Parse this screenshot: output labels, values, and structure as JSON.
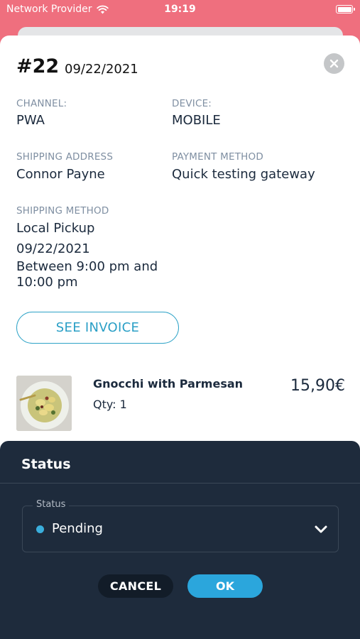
{
  "status_bar": {
    "carrier": "Network Provider",
    "time": "19:19",
    "wifi_icon": "wifi-icon",
    "battery_icon": "battery-icon"
  },
  "order": {
    "number": "#22",
    "date": "09/22/2021",
    "channel_label": "CHANNEL:",
    "channel_value": "PWA",
    "device_label": "DEVICE:",
    "device_value": "MOBILE",
    "shipping_address_label": "SHIPPING ADDRESS",
    "shipping_address_value": "Connor Payne",
    "payment_method_label": "PAYMENT METHOD",
    "payment_method_value": "Quick testing gateway",
    "shipping_method_label": "SHIPPING METHOD",
    "shipping_method_value": "Local Pickup",
    "shipping_date": "09/22/2021",
    "shipping_window_line1": "Between 9:00 pm and",
    "shipping_window_line2": "10:00 pm",
    "invoice_button": "SEE INVOICE",
    "close_icon": "close-icon"
  },
  "items": [
    {
      "name": "Gnocchi with Parmesan",
      "qty": "Qty: 1",
      "price": "15,90€",
      "thumbnail": "food-photo"
    }
  ],
  "status_panel": {
    "title": "Status",
    "select_label": "Status",
    "select_value": "Pending",
    "status_dot_color": "#3aaedc",
    "chevron_icon": "chevron-down-icon",
    "cancel_button": "CANCEL",
    "ok_button": "OK"
  },
  "colors": {
    "header": "#ef6f7e",
    "accent": "#2ba6dc",
    "panel": "#1e2b3c"
  }
}
